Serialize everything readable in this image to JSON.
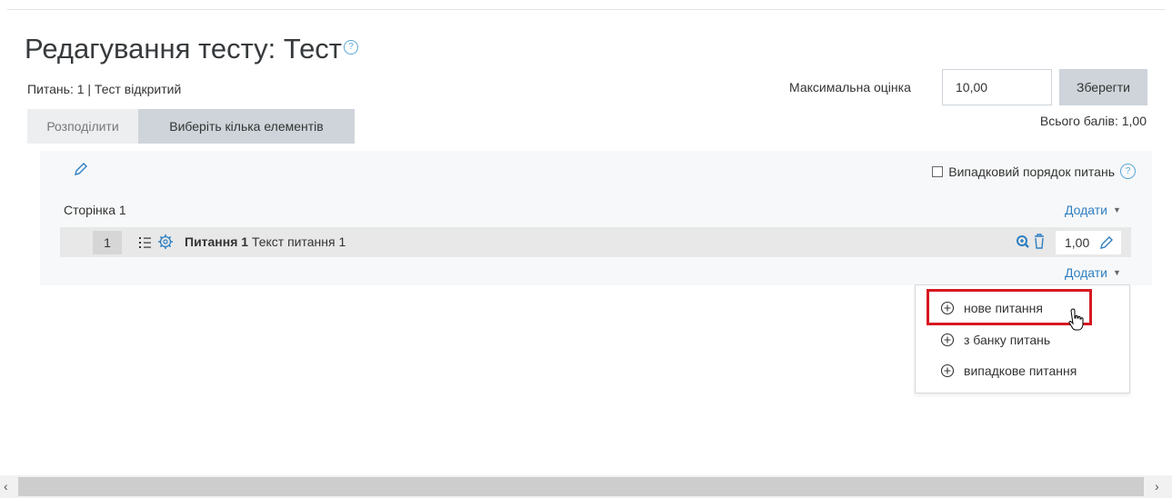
{
  "page": {
    "title": "Редагування тесту: Тест",
    "help_glyph": "?",
    "info": "Питань: 1 | Тест відкритий"
  },
  "grade": {
    "max_label": "Максимальна оцінка",
    "max_value": "10,00",
    "save_label": "Зберегти",
    "total": "Всього балів: 1,00"
  },
  "toolbar": {
    "repaginate_label": "Розподілити",
    "select_multiple_label": "Виберіть кілька елементів"
  },
  "section": {
    "shuffle_label": "Випадковий порядок питань",
    "page_label": "Сторінка 1",
    "add_label": "Додати",
    "add_label_bottom": "Додати"
  },
  "question": {
    "number": "1",
    "name": "Питання 1",
    "text": "Текст питання 1",
    "mark": "1,00"
  },
  "add_menu": {
    "items": [
      {
        "label": "нове питання"
      },
      {
        "label": "з банку питань"
      },
      {
        "label": "випадкове питання"
      }
    ]
  },
  "colors": {
    "link": "#2f7fc1",
    "highlight": "#d71921",
    "help": "#5aa6d6"
  },
  "icons": [
    "pencil-icon",
    "question-mark-icon",
    "list-icon",
    "gear-icon",
    "search-icon",
    "trash-icon",
    "plus-circle-icon",
    "hand-cursor-icon",
    "chevron-left-icon",
    "chevron-right-icon"
  ]
}
